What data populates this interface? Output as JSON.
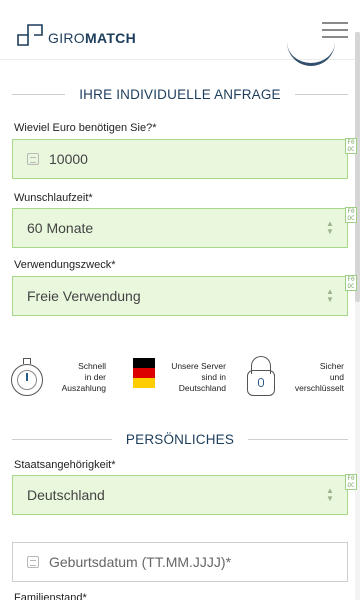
{
  "header": {
    "logo_light": "GIRO",
    "logo_bold": "MATCH"
  },
  "colors": {
    "brand": "#1d3d5c",
    "field_valid_bg": "#e9f7dd",
    "field_valid_border": "#a8d88a"
  },
  "icons": {
    "menu": "hamburger-menu-icon",
    "field": "calendar-icon",
    "select": "up-down-stepper-icon",
    "speed": "stopwatch-icon",
    "server": "germany-flag-icon",
    "security": "lock-icon"
  },
  "sections": {
    "request_title": "IHRE INDIVIDUELLE ANFRAGE",
    "personal_title": "PERSÖNLICHES"
  },
  "form": {
    "amount": {
      "label": "Wieviel Euro benötigen Sie?*",
      "value": "10000"
    },
    "term": {
      "label": "Wunschlaufzeit*",
      "value": "60 Monate"
    },
    "purpose": {
      "label": "Verwendungszweck*",
      "value": "Freie Verwendung"
    },
    "nationality": {
      "label": "Staatsangehörigkeit*",
      "value": "Deutschland"
    },
    "birthdate": {
      "placeholder": "Geburtsdatum (TT.MM.JJJJ)*"
    },
    "marital_label": "Familienstand*"
  },
  "trust": {
    "speed": [
      "Schnell",
      "in der",
      "Auszahlung"
    ],
    "server": [
      "Unsere Server",
      "sind in",
      "Deutschland"
    ],
    "security": [
      "Sicher",
      "und",
      "verschlüsselt"
    ]
  },
  "badge_text": "F0\nOC"
}
